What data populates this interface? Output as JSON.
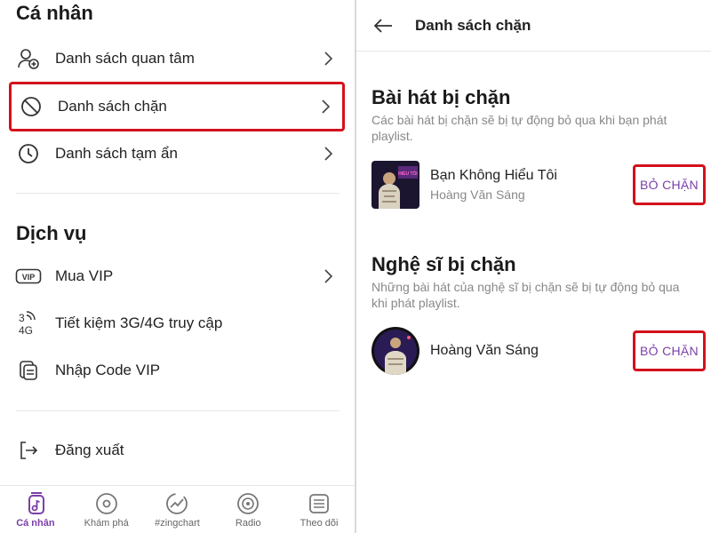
{
  "left": {
    "personal_title": "Cá nhân",
    "personal_items": [
      {
        "label": "Danh sách quan tâm",
        "icon": "add-user-icon"
      },
      {
        "label": "Danh sách chặn",
        "icon": "block-icon"
      },
      {
        "label": "Danh sách tạm ẩn",
        "icon": "clock-icon"
      }
    ],
    "services_title": "Dịch vụ",
    "service_items": [
      {
        "label": "Mua VIP",
        "icon": "vip-icon",
        "icon_text": "VIP"
      },
      {
        "label": "Tiết kiệm 3G/4G truy cập",
        "icon": "network-icon",
        "icon_text_top": "3",
        "icon_text_bottom": "4G"
      },
      {
        "label": "Nhập Code VIP",
        "icon": "code-icon"
      }
    ],
    "logout_label": "Đăng xuất"
  },
  "bottom_nav": [
    {
      "label": "Cá nhân",
      "icon": "library-icon",
      "active": true
    },
    {
      "label": "Khám phá",
      "icon": "disc-icon",
      "active": false
    },
    {
      "label": "#zingchart",
      "icon": "chart-icon",
      "active": false
    },
    {
      "label": "Radio",
      "icon": "radio-icon",
      "active": false
    },
    {
      "label": "Theo dõi",
      "icon": "feed-icon",
      "active": false
    }
  ],
  "right": {
    "header_title": "Danh sách chặn",
    "songs_title": "Bài hát bị chặn",
    "songs_desc": "Các bài hát bị chặn sẽ bị tự động bỏ qua khi bạn phát playlist.",
    "song": {
      "title": "Bạn Không Hiểu Tôi",
      "artist": "Hoàng Văn Sáng",
      "thumb_text": "HIỂU TÔI"
    },
    "artists_title": "Nghệ sĩ bị chặn",
    "artists_desc": "Những bài hát của nghệ sĩ bị chặn sẽ bị tự động bỏ qua khi phát playlist.",
    "artist": {
      "name": "Hoàng Văn Sáng"
    },
    "unblock_label": "BỎ CHẶN"
  },
  "colors": {
    "accent": "#7b3fa8",
    "highlight": "#d3111c"
  }
}
